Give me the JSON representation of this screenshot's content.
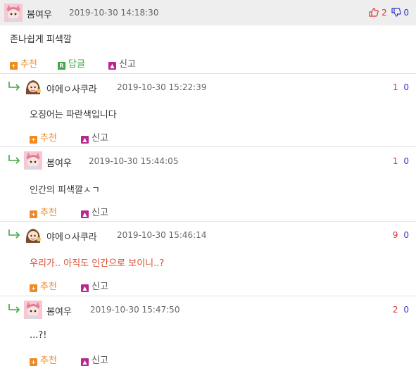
{
  "post": {
    "nick": "봄여우",
    "date": "2019-10-30 14:18:30",
    "up": "2",
    "down": "0",
    "text": "존나쉽게 피색깔",
    "actions": {
      "recommend": "추천",
      "reply": "답글",
      "report": "신고"
    }
  },
  "replies": [
    {
      "nick": "야에ㅇ사쿠라",
      "date": "2019-10-30 15:22:39",
      "up": "1",
      "down": "0",
      "text": "오징어는 파란색입니다",
      "recommend": "추천",
      "report": "신고"
    },
    {
      "nick": "봄여우",
      "date": "2019-10-30 15:44:05",
      "up": "1",
      "down": "0",
      "text": "인간의 피색깔ㅅㄱ",
      "recommend": "추천",
      "report": "신고"
    },
    {
      "nick": "야에ㅇ사쿠라",
      "date": "2019-10-30 15:46:14",
      "up": "9",
      "down": "0",
      "text": "우리가.. 아직도 인간으로 보이니..?",
      "recommend": "추천",
      "report": "신고"
    },
    {
      "nick": "봄여우",
      "date": "2019-10-30 15:47:50",
      "up": "2",
      "down": "0",
      "text": "...?!",
      "recommend": "추천",
      "report": "신고"
    }
  ],
  "colors": {
    "up": "#dd3333",
    "down": "#3333cc",
    "highlight_text": "#d84a2a",
    "recommend": "#f08a24",
    "reply": "#41a742",
    "report_icon": "#b8268e"
  },
  "icons": {
    "thumb_up": "thumbs-up-icon",
    "thumb_down": "thumbs-down-icon",
    "reply_arrow": "reply-arrow-icon",
    "recommend": "plus-icon",
    "reply": "reply-icon",
    "report": "siren-icon"
  }
}
